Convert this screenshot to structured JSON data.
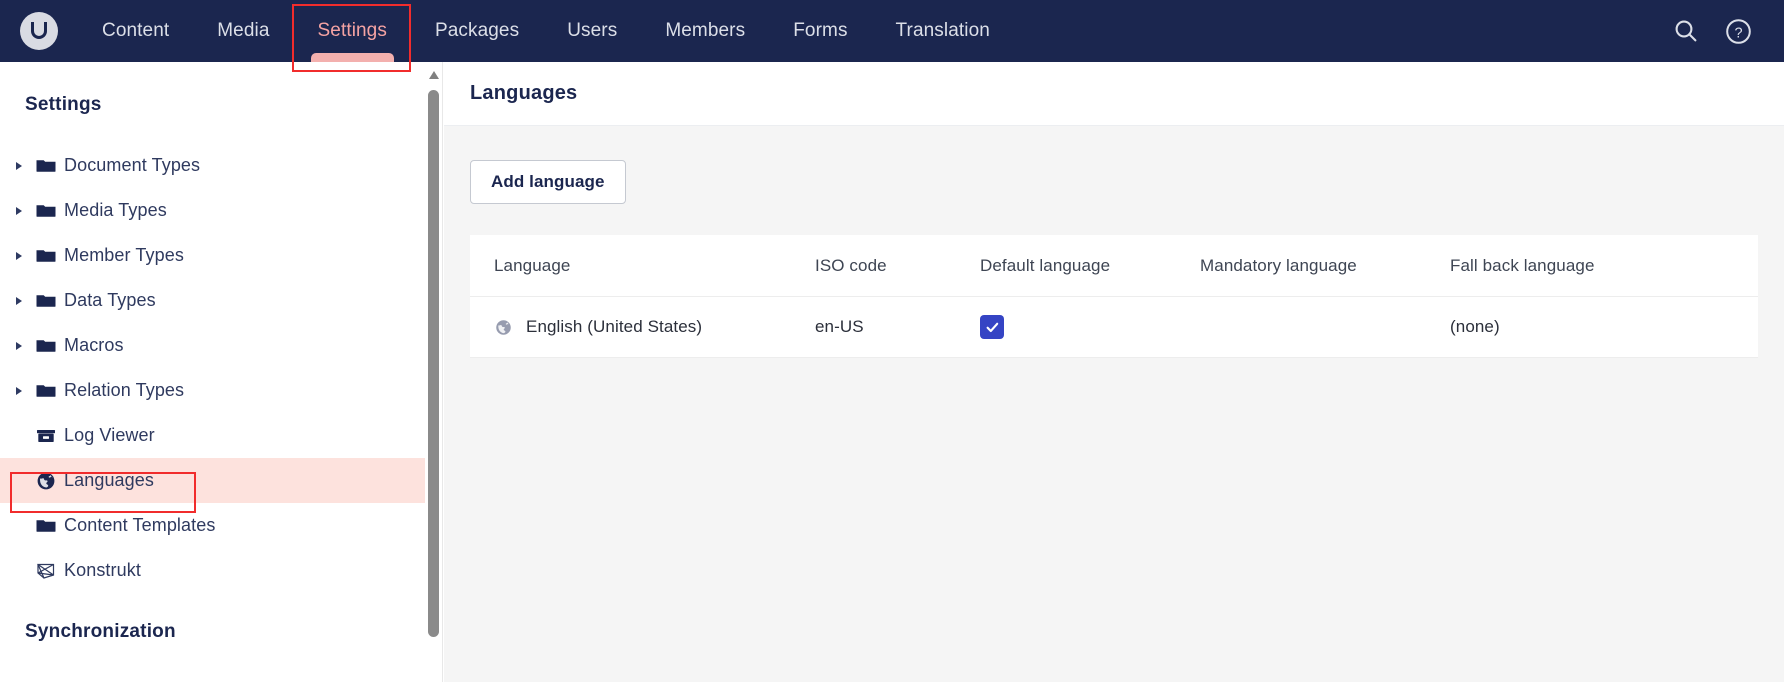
{
  "topnav": {
    "logo_name": "umbraco-logo",
    "items": [
      {
        "label": "Content",
        "active": false
      },
      {
        "label": "Media",
        "active": false
      },
      {
        "label": "Settings",
        "active": true
      },
      {
        "label": "Packages",
        "active": false
      },
      {
        "label": "Users",
        "active": false
      },
      {
        "label": "Members",
        "active": false
      },
      {
        "label": "Forms",
        "active": false
      },
      {
        "label": "Translation",
        "active": false
      }
    ],
    "right_icons": [
      {
        "name": "search-icon"
      },
      {
        "name": "help-icon"
      }
    ]
  },
  "sidebar": {
    "title": "Settings",
    "items": [
      {
        "label": "Document Types",
        "icon": "folder-icon",
        "expandable": true,
        "selected": false
      },
      {
        "label": "Media Types",
        "icon": "folder-icon",
        "expandable": true,
        "selected": false
      },
      {
        "label": "Member Types",
        "icon": "folder-icon",
        "expandable": true,
        "selected": false
      },
      {
        "label": "Data Types",
        "icon": "folder-icon",
        "expandable": true,
        "selected": false
      },
      {
        "label": "Macros",
        "icon": "folder-icon",
        "expandable": true,
        "selected": false
      },
      {
        "label": "Relation Types",
        "icon": "folder-icon",
        "expandable": true,
        "selected": false
      },
      {
        "label": "Log Viewer",
        "icon": "log-viewer-icon",
        "expandable": false,
        "selected": false
      },
      {
        "label": "Languages",
        "icon": "globe-icon",
        "expandable": false,
        "selected": true
      },
      {
        "label": "Content Templates",
        "icon": "folder-icon",
        "expandable": false,
        "selected": false
      },
      {
        "label": "Konstrukt",
        "icon": "konstrukt-icon",
        "expandable": false,
        "selected": false
      }
    ],
    "section_label": "Synchronization"
  },
  "main": {
    "title": "Languages",
    "add_language_label": "Add language",
    "table": {
      "headers": [
        "Language",
        "ISO code",
        "Default language",
        "Mandatory language",
        "Fall back language"
      ],
      "rows": [
        {
          "language": "English (United States)",
          "language_icon": "globe-icon",
          "iso_code": "en-US",
          "default_language": true,
          "mandatory_language": "",
          "fall_back_language": "(none)"
        }
      ]
    }
  },
  "scrollbar": {
    "name": "sidebar-scrollbar"
  },
  "annotations": [
    {
      "name": "annotation-settings-tab",
      "color": "#f12c2c"
    },
    {
      "name": "annotation-languages-item",
      "color": "#f12c2c"
    }
  ],
  "colors": {
    "nav_background": "#1b264f",
    "accent_pink": "#f3b0ae",
    "active_tab_text": "#f5a3a3",
    "selected_row": "#fde2dd",
    "checkbox_blue": "#3544c4",
    "content_background": "#f5f5f5",
    "annotation_red": "#f12c2c"
  }
}
